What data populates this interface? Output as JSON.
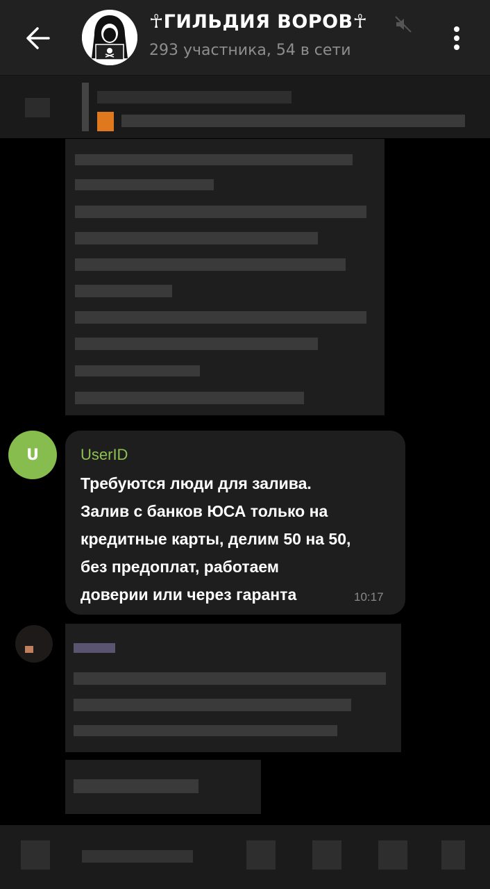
{
  "header": {
    "title": "☥ГИЛЬДИЯ ВОРОВ☥",
    "subtitle": "293 участника, 54 в сети",
    "back_icon": "arrow-left-icon",
    "menu_icon": "more-vertical-icon",
    "mute_icon": "muted-speaker-icon"
  },
  "message": {
    "avatar_letter": "U",
    "sender": "UserID",
    "lines": [
      "Требуются люди для залива.",
      "Залив с банков ЮСА только на",
      "кредитные карты, делим 50 на 50,",
      "без предоплат, работаем",
      "доверии или через гаранта"
    ],
    "time": "10:17"
  },
  "colors": {
    "header_bg": "#212121",
    "bubble_bg": "#1e1e1e",
    "sender_color": "#8cc152",
    "avatar_bg": "#86bd4e"
  }
}
